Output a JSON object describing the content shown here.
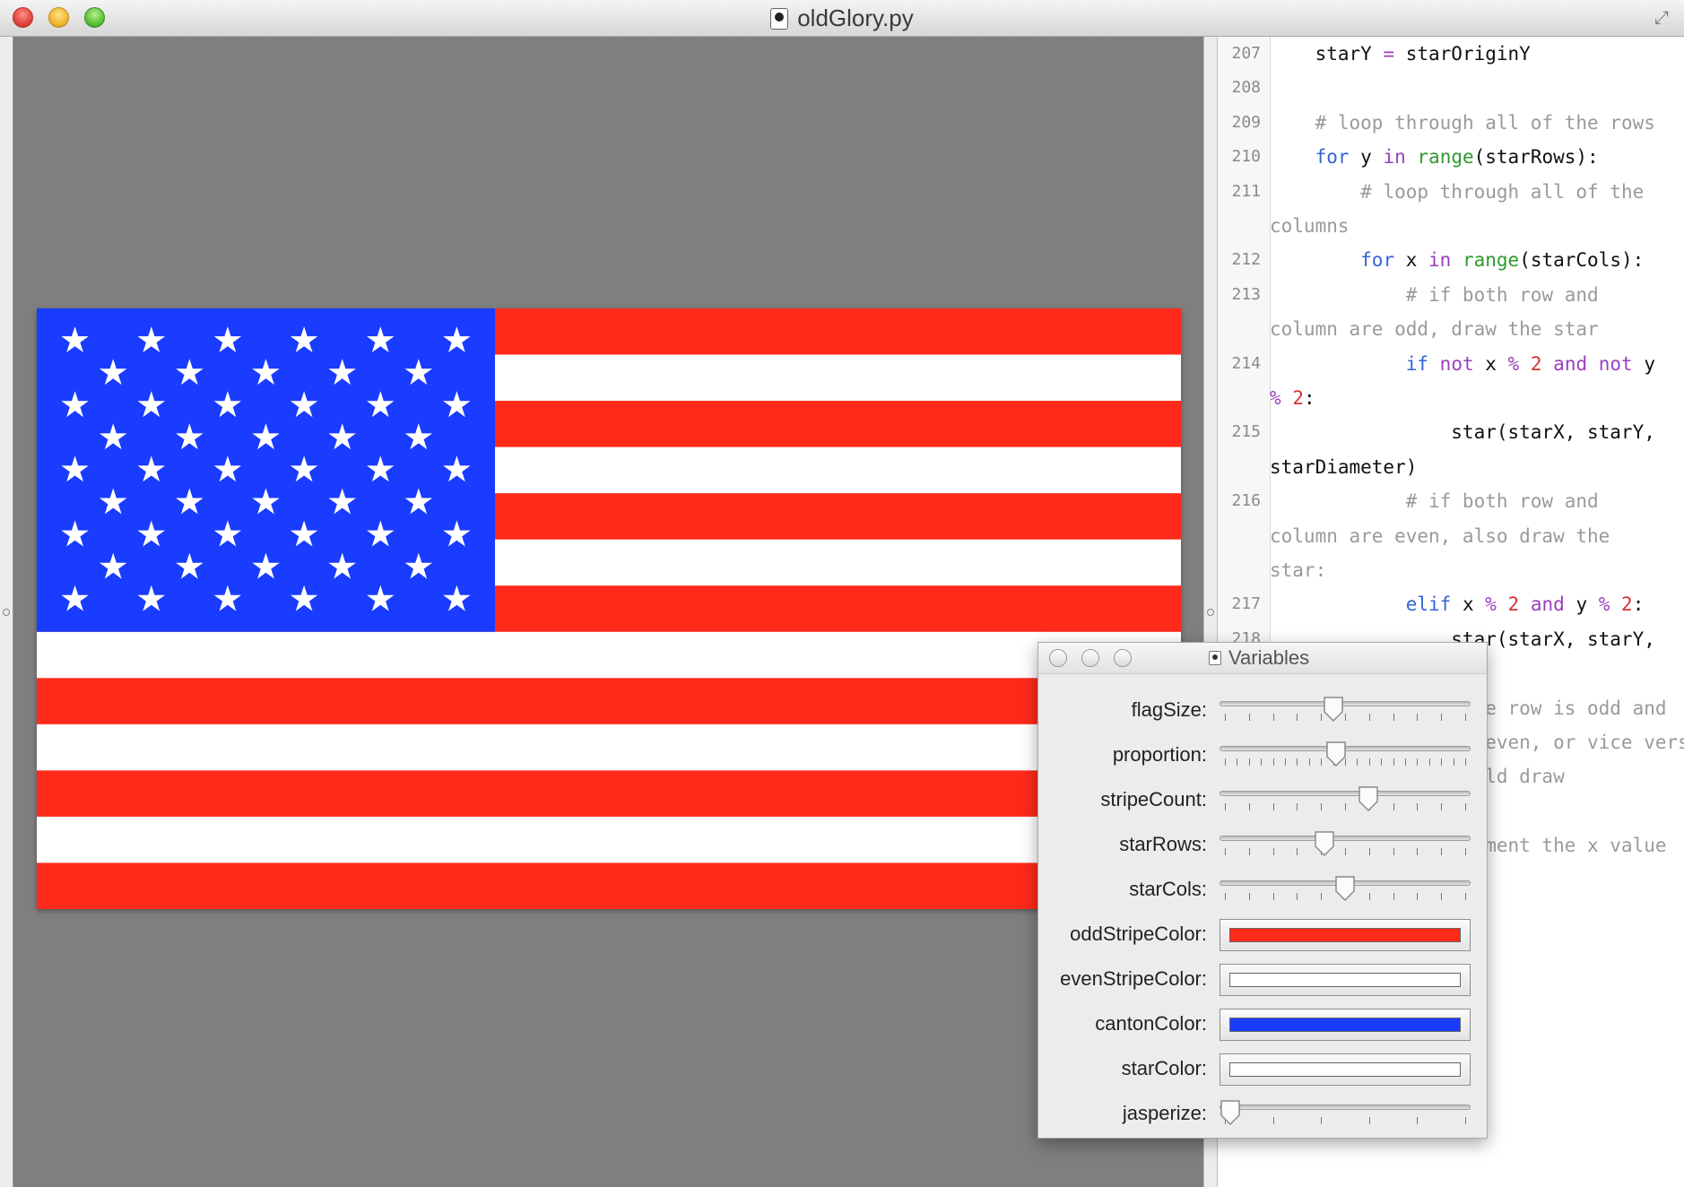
{
  "window": {
    "title": "oldGlory.py"
  },
  "flag": {
    "stripe_count": 13,
    "star_rows": 9,
    "star_cols": 11,
    "odd_stripe_color": "#ff2a1a",
    "even_stripe_color": "#ffffff",
    "canton_color": "#1a3cff",
    "star_color": "#ffffff"
  },
  "editor": {
    "lines": [
      {
        "num": "207",
        "html": "    starY <span class=\"op\">=</span> starOriginY"
      },
      {
        "num": "208",
        "html": ""
      },
      {
        "num": "209",
        "html": "    <span class=\"cm\"># loop through all of the rows</span>"
      },
      {
        "num": "210",
        "html": "    <span class=\"kw\">for</span> y <span class=\"op\">in</span> <span class=\"fn\">range</span>(starRows):"
      },
      {
        "num": "211",
        "html": "        <span class=\"cm\"># loop through all of the</span>"
      },
      {
        "num": "",
        "html": "<span class=\"cm\">columns</span>"
      },
      {
        "num": "212",
        "html": "        <span class=\"kw\">for</span> x <span class=\"op\">in</span> <span class=\"fn\">range</span>(starCols):"
      },
      {
        "num": "213",
        "html": "            <span class=\"cm\"># if both row and</span>"
      },
      {
        "num": "",
        "html": "<span class=\"cm\">column are odd, draw the star</span>"
      },
      {
        "num": "214",
        "html": "            <span class=\"kw\">if</span> <span class=\"op\">not</span> x <span class=\"op\">%</span> <span class=\"nm\">2</span> <span class=\"op\">and</span> <span class=\"op\">not</span> y"
      },
      {
        "num": "",
        "html": "<span class=\"op\">%</span> <span class=\"nm\">2</span>:"
      },
      {
        "num": "215",
        "html": "                star(starX, starY,"
      },
      {
        "num": "",
        "html": "starDiameter)"
      },
      {
        "num": "216",
        "html": "            <span class=\"cm\"># if both row and</span>"
      },
      {
        "num": "",
        "html": "<span class=\"cm\">column are even, also draw the</span>"
      },
      {
        "num": "",
        "html": "<span class=\"cm\">star:</span>"
      },
      {
        "num": "217",
        "html": "            <span class=\"kw\">elif</span> x <span class=\"op\">%</span> <span class=\"nm\">2</span> <span class=\"op\">and</span> y <span class=\"op\">%</span> <span class=\"nm\">2</span>:"
      },
      {
        "num": "218",
        "html": "                star(starX, starY,"
      },
      {
        "num": "",
        "html": ""
      },
      {
        "num": "",
        "html": "<span class=\"cm\">            # if the row is odd and</span>"
      },
      {
        "num": "",
        "html": "<span class=\"cm\">            column even, or vice versa</span>"
      },
      {
        "num": "",
        "html": "<span class=\"cm\">            we should draw</span>"
      },
      {
        "num": "",
        "html": ""
      },
      {
        "num": "",
        "html": "<span class=\"cm\">            # increment the x value</span>"
      }
    ]
  },
  "variables_panel": {
    "title": "Variables",
    "sliders": [
      {
        "label": "flagSize:",
        "value": 0.45,
        "ticks": 11
      },
      {
        "label": "proportion:",
        "value": 0.46,
        "ticks": 21
      },
      {
        "label": "stripeCount:",
        "value": 0.6,
        "ticks": 11
      },
      {
        "label": "starRows:",
        "value": 0.41,
        "ticks": 11
      },
      {
        "label": "starCols:",
        "value": 0.5,
        "ticks": 11
      }
    ],
    "colors": [
      {
        "label": "oddStripeColor:",
        "value": "#ff2a1a"
      },
      {
        "label": "evenStripeColor:",
        "value": "#ffffff"
      },
      {
        "label": "cantonColor:",
        "value": "#1a3cff"
      },
      {
        "label": "starColor:",
        "value": "#ffffff"
      }
    ],
    "jasperize": {
      "label": "jasperize:",
      "value": 0.0,
      "ticks": 6
    }
  }
}
